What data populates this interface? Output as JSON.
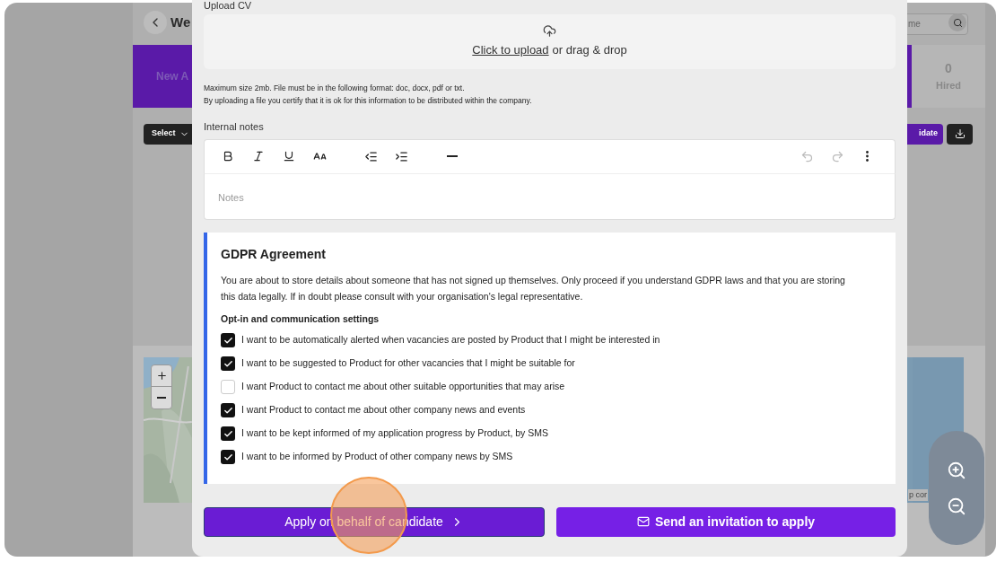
{
  "background_page": {
    "title": "We",
    "search": {
      "placeholder": "me"
    },
    "stat_card": "New A",
    "hired": {
      "count": "0",
      "label": "Hired"
    },
    "select": "Select",
    "add_button": "idate",
    "map_attribution": "p cor"
  },
  "modal": {
    "upload": {
      "label": "Upload CV",
      "link": "Click to upload",
      "rest": "or drag & drop",
      "help": [
        "Maximum size 2mb. File must be in the following format: doc, docx, pdf or txt.",
        "By uploading a file you certify that it is ok for this information to be distributed within the company."
      ]
    },
    "notes": {
      "label": "Internal notes",
      "placeholder": "Notes"
    },
    "gdpr": {
      "title": "GDPR Agreement",
      "text": "You are about to store details about someone that has not signed up themselves. Only proceed if you understand GDPR laws and that you are storing this data legally. If in doubt please consult with your organisation's legal representative.",
      "settings_title": "Opt-in and communication settings",
      "options": [
        {
          "label": "I want to be automatically alerted when vacancies are posted by Product that I might be interested in",
          "checked": true
        },
        {
          "label": "I want to be suggested to Product for other vacancies that I might be suitable for",
          "checked": true
        },
        {
          "label": "I want Product to contact me about other suitable opportunities that may arise",
          "checked": false
        },
        {
          "label": "I want Product to contact me about other company news and events",
          "checked": true
        },
        {
          "label": "I want to be kept informed of my application progress by Product, by SMS",
          "checked": true
        },
        {
          "label": "I want to be informed by Product of other company news by SMS",
          "checked": true
        }
      ]
    },
    "actions": [
      {
        "label": "Apply on behalf of candidate",
        "kind": "apply"
      },
      {
        "label": "Send an invitation to apply",
        "kind": "invite"
      }
    ]
  }
}
